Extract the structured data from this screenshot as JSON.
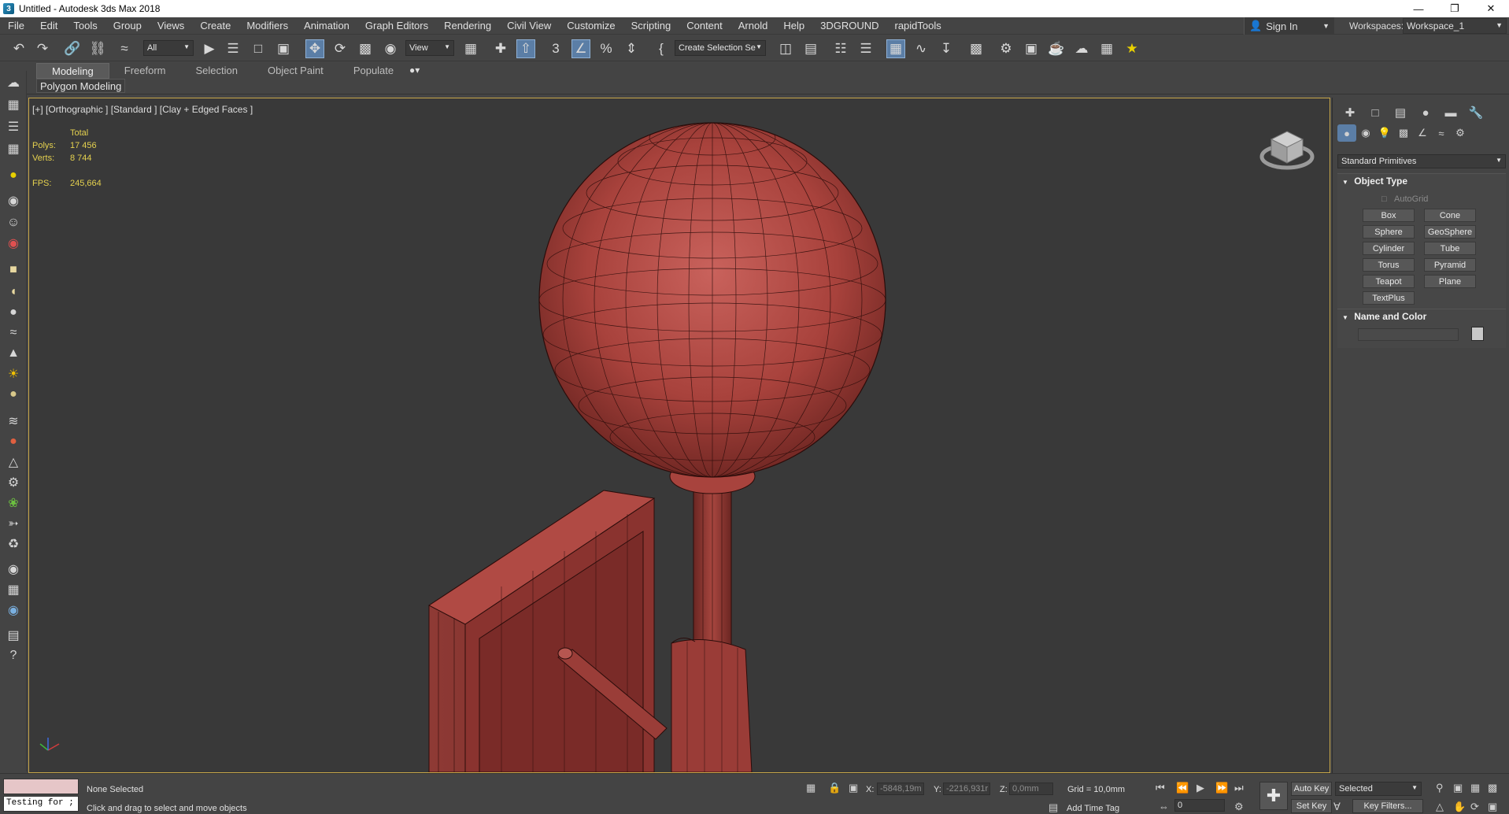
{
  "window": {
    "title": "Untitled - Autodesk 3ds Max 2018",
    "app_icon": "3"
  },
  "menu": {
    "items": [
      "File",
      "Edit",
      "Tools",
      "Group",
      "Views",
      "Create",
      "Modifiers",
      "Animation",
      "Graph Editors",
      "Rendering",
      "Civil View",
      "Customize",
      "Scripting",
      "Content",
      "Arnold",
      "Help",
      "3DGROUND",
      "rapidTools"
    ],
    "sign_in": "Sign In",
    "workspaces_label": "Workspaces:",
    "workspace_value": "Workspace_1"
  },
  "toolbar": {
    "selection_filter": "All",
    "ref_coord": "View",
    "named_selection_placeholder": "Create Selection Se"
  },
  "ribbon": {
    "tabs": [
      "Modeling",
      "Freeform",
      "Selection",
      "Object Paint",
      "Populate"
    ],
    "active_tab": "Modeling",
    "sub_panel": "Polygon Modeling"
  },
  "viewport": {
    "label": "[+] [Orthographic ] [Standard ] [Clay + Edged Faces ]",
    "stats": {
      "total_label": "Total",
      "polys_label": "Polys:",
      "polys_value": "17 456",
      "verts_label": "Verts:",
      "verts_value": "8 744",
      "fps_label": "FPS:",
      "fps_value": "245,664"
    },
    "model_color": "#b54a44",
    "border_color": "#c8a74a"
  },
  "command_panel": {
    "category_dropdown": "Standard Primitives",
    "object_type_title": "Object Type",
    "autogrid_label": "AutoGrid",
    "object_buttons": [
      "Box",
      "Cone",
      "Sphere",
      "GeoSphere",
      "Cylinder",
      "Tube",
      "Torus",
      "Pyramid",
      "Teapot",
      "Plane",
      "TextPlus"
    ],
    "name_color_title": "Name and Color"
  },
  "status": {
    "maxscript_input": "Testing for ;",
    "selection_status": "None Selected",
    "prompt": "Click and drag to select and move objects",
    "x_label": "X:",
    "x_value": "-5848,19m",
    "y_label": "Y:",
    "y_value": "-2216,931r",
    "z_label": "Z:",
    "z_value": "0,0mm",
    "grid": "Grid = 10,0mm",
    "add_time_tag": "Add Time Tag",
    "frame": "0",
    "auto_key": "Auto Key",
    "set_key": "Set Key",
    "key_mode": "Selected",
    "key_filters": "Key Filters..."
  }
}
